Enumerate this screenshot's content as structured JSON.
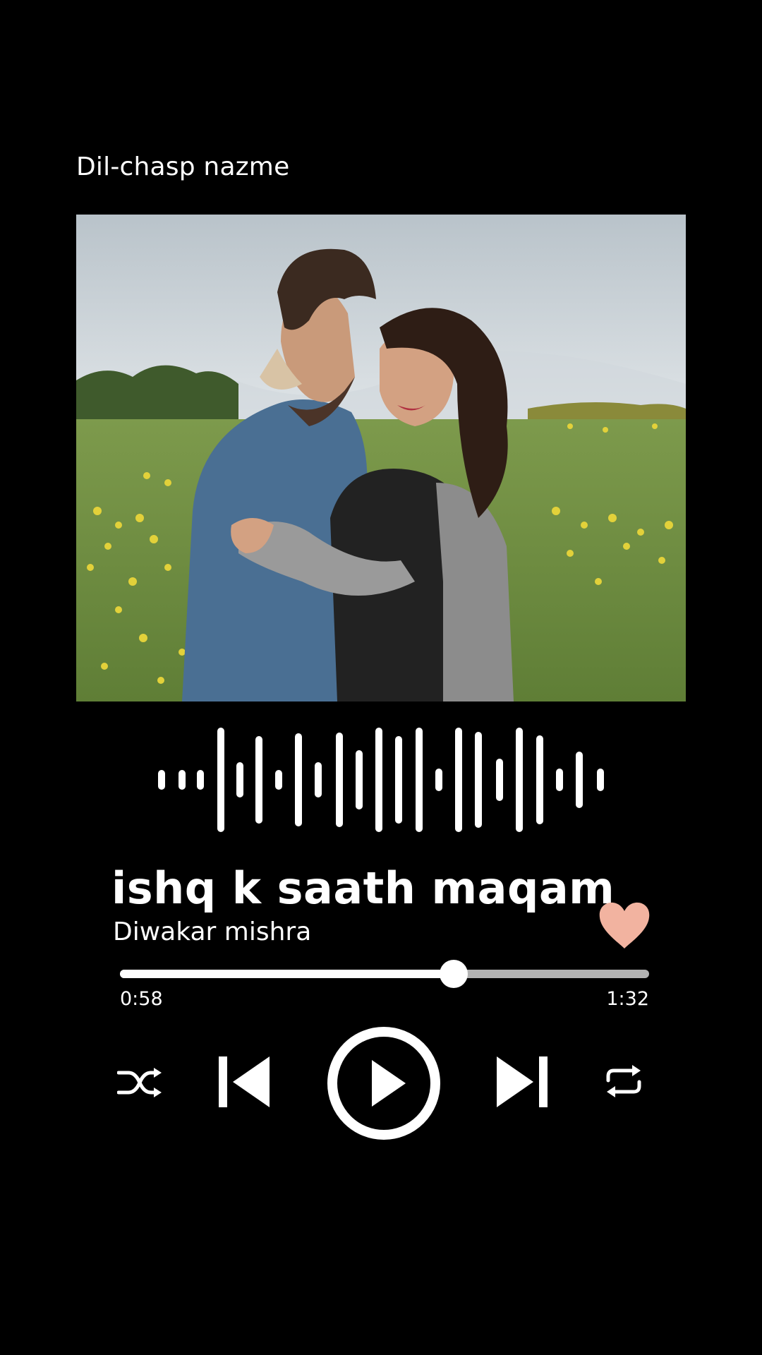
{
  "playlist": {
    "title": "Dil-chasp nazme"
  },
  "song": {
    "title": "ishq k saath maqam",
    "artist": "Diwakar mishra",
    "liked": true
  },
  "playback": {
    "elapsed": "0:58",
    "total": "1:32",
    "progress": 0.63
  },
  "icons": {
    "like": "heart-icon",
    "shuffle": "shuffle-icon",
    "previous": "skip-previous-icon",
    "play": "play-icon",
    "next": "skip-next-icon",
    "repeat": "repeat-icon"
  },
  "colors": {
    "background": "#000000",
    "foreground": "#ffffff",
    "heart": "#f2b3a0",
    "track": "#b3b3b3"
  }
}
